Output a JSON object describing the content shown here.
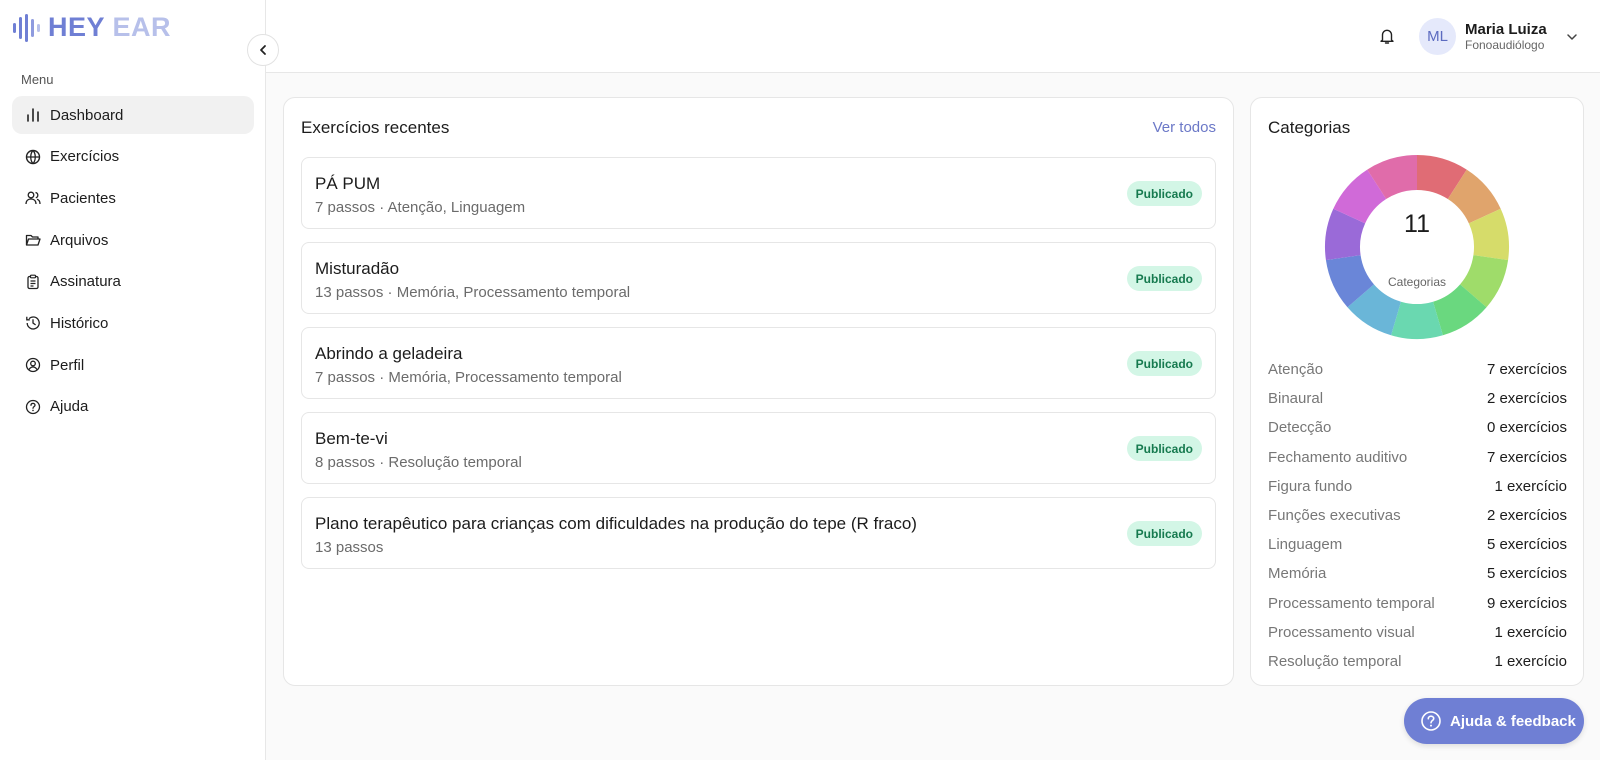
{
  "brand": {
    "hey": "HEY",
    "ear": "EAR",
    "color_primary": "#6f7fd4",
    "color_secondary": "#b7c0ea"
  },
  "sidebar": {
    "menu_label": "Menu",
    "items": [
      {
        "label": "Dashboard",
        "icon": "bar-chart-icon",
        "active": true
      },
      {
        "label": "Exercícios",
        "icon": "globe-icon",
        "active": false
      },
      {
        "label": "Pacientes",
        "icon": "users-icon",
        "active": false
      },
      {
        "label": "Arquivos",
        "icon": "folder-open-icon",
        "active": false
      },
      {
        "label": "Assinatura",
        "icon": "clipboard-icon",
        "active": false
      },
      {
        "label": "Histórico",
        "icon": "history-icon",
        "active": false
      },
      {
        "label": "Perfil",
        "icon": "user-circle-icon",
        "active": false
      },
      {
        "label": "Ajuda",
        "icon": "help-circle-icon",
        "active": false
      }
    ]
  },
  "header": {
    "user": {
      "initials": "ML",
      "name": "Maria Luiza",
      "role": "Fonoaudiólogo"
    }
  },
  "recent": {
    "title": "Exercícios recentes",
    "see_all": "Ver todos",
    "items": [
      {
        "title": "PÁ PUM",
        "subtitle": "7 passos · Atenção, Linguagem",
        "status": "Publicado"
      },
      {
        "title": "Misturadão",
        "subtitle": "13 passos · Memória, Processamento temporal",
        "status": "Publicado"
      },
      {
        "title": "Abrindo a geladeira",
        "subtitle": "7 passos · Memória, Processamento temporal",
        "status": "Publicado"
      },
      {
        "title": "Bem-te-vi",
        "subtitle": "8 passos · Resolução temporal",
        "status": "Publicado"
      },
      {
        "title": "Plano terapêutico para crianças com dificuldades na produção do tepe (R fraco)",
        "subtitle": "13 passos",
        "status": "Publicado"
      }
    ]
  },
  "categories": {
    "title": "Categorias",
    "total": "11",
    "total_label": "Categorias",
    "donut_colors": [
      "#e06c75",
      "#e0a46c",
      "#d6dc6a",
      "#9fdc6a",
      "#6ad87f",
      "#6ad8b0",
      "#6ab6d8",
      "#6a86d8",
      "#9a6ad8",
      "#d06ad8",
      "#e06caa"
    ],
    "items": [
      {
        "name": "Atenção",
        "count": "7 exercícios"
      },
      {
        "name": "Binaural",
        "count": "2 exercícios"
      },
      {
        "name": "Detecção",
        "count": "0 exercícios"
      },
      {
        "name": "Fechamento auditivo",
        "count": "7 exercícios"
      },
      {
        "name": "Figura fundo",
        "count": "1 exercício"
      },
      {
        "name": "Funções executivas",
        "count": "2 exercícios"
      },
      {
        "name": "Linguagem",
        "count": "5 exercícios"
      },
      {
        "name": "Memória",
        "count": "5 exercícios"
      },
      {
        "name": "Processamento temporal",
        "count": "9 exercícios"
      },
      {
        "name": "Processamento visual",
        "count": "1 exercício"
      },
      {
        "name": "Resolução temporal",
        "count": "1 exercício"
      }
    ]
  },
  "help_button": {
    "label": "Ajuda & feedback"
  }
}
